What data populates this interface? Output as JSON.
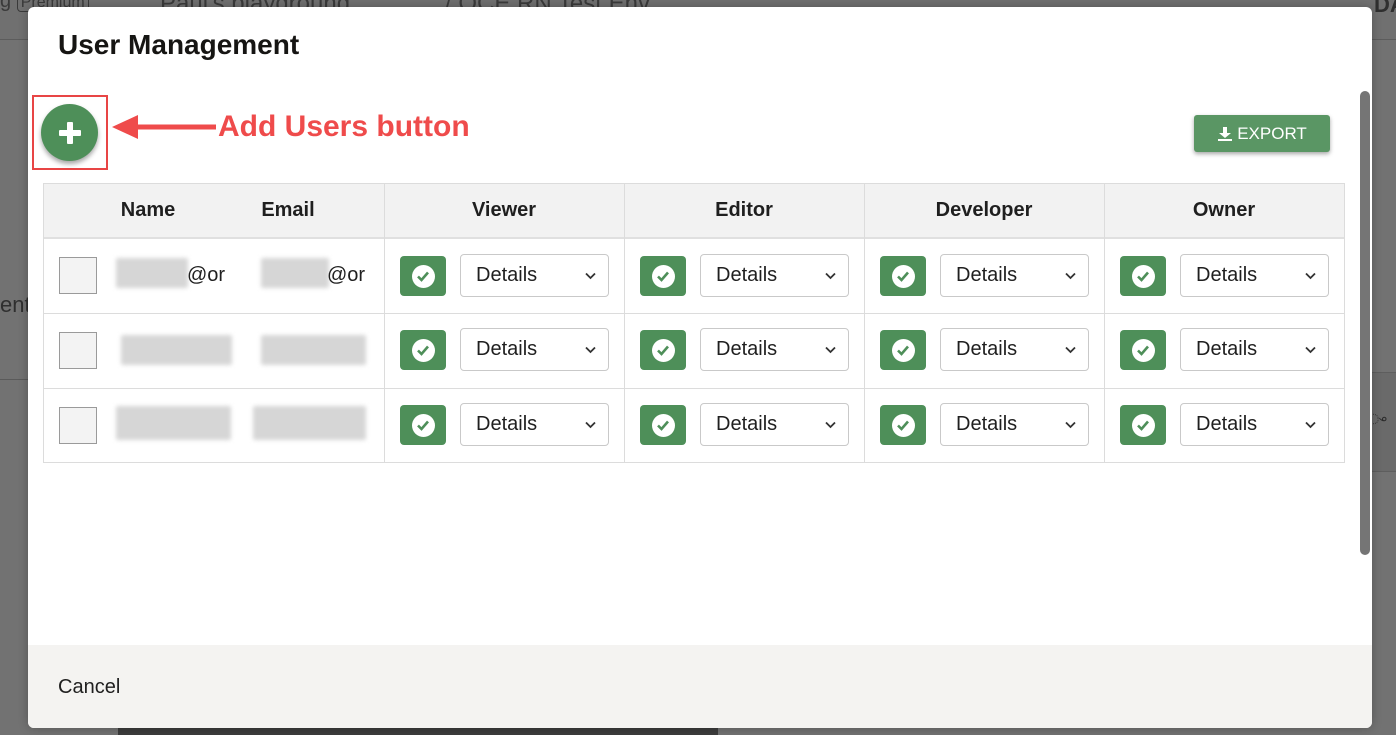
{
  "background": {
    "left_tab_text": "g",
    "plan_badge": "Premium",
    "playground_name": "Paul's playground",
    "env_name": "/ OCE RN Test Env",
    "top_right_text": "DA",
    "side_text": "ent"
  },
  "modal": {
    "title": "User Management",
    "add_button_annotation": "Add Users button",
    "export_label": "EXPORT",
    "columns": {
      "name": "Name",
      "email": "Email",
      "viewer": "Viewer",
      "editor": "Editor",
      "developer": "Developer",
      "owner": "Owner"
    },
    "rows": [
      {
        "name_visible": "@or",
        "email_visible": "@or",
        "roles": [
          "Details",
          "Details",
          "Details",
          "Details"
        ]
      },
      {
        "name_visible": "",
        "email_visible": "",
        "roles": [
          "Details",
          "Details",
          "Details",
          "Details"
        ]
      },
      {
        "name_visible": "",
        "email_visible": "",
        "roles": [
          "Details",
          "Details",
          "Details",
          "Details"
        ]
      }
    ],
    "cancel_label": "Cancel"
  },
  "colors": {
    "accent_green": "#4e8f59",
    "annotation_red": "#ef4b4b"
  },
  "icons": {
    "add": "plus-icon",
    "export": "download-icon",
    "role_checked": "check-circle-icon",
    "dropdown": "chevron-down-icon"
  }
}
